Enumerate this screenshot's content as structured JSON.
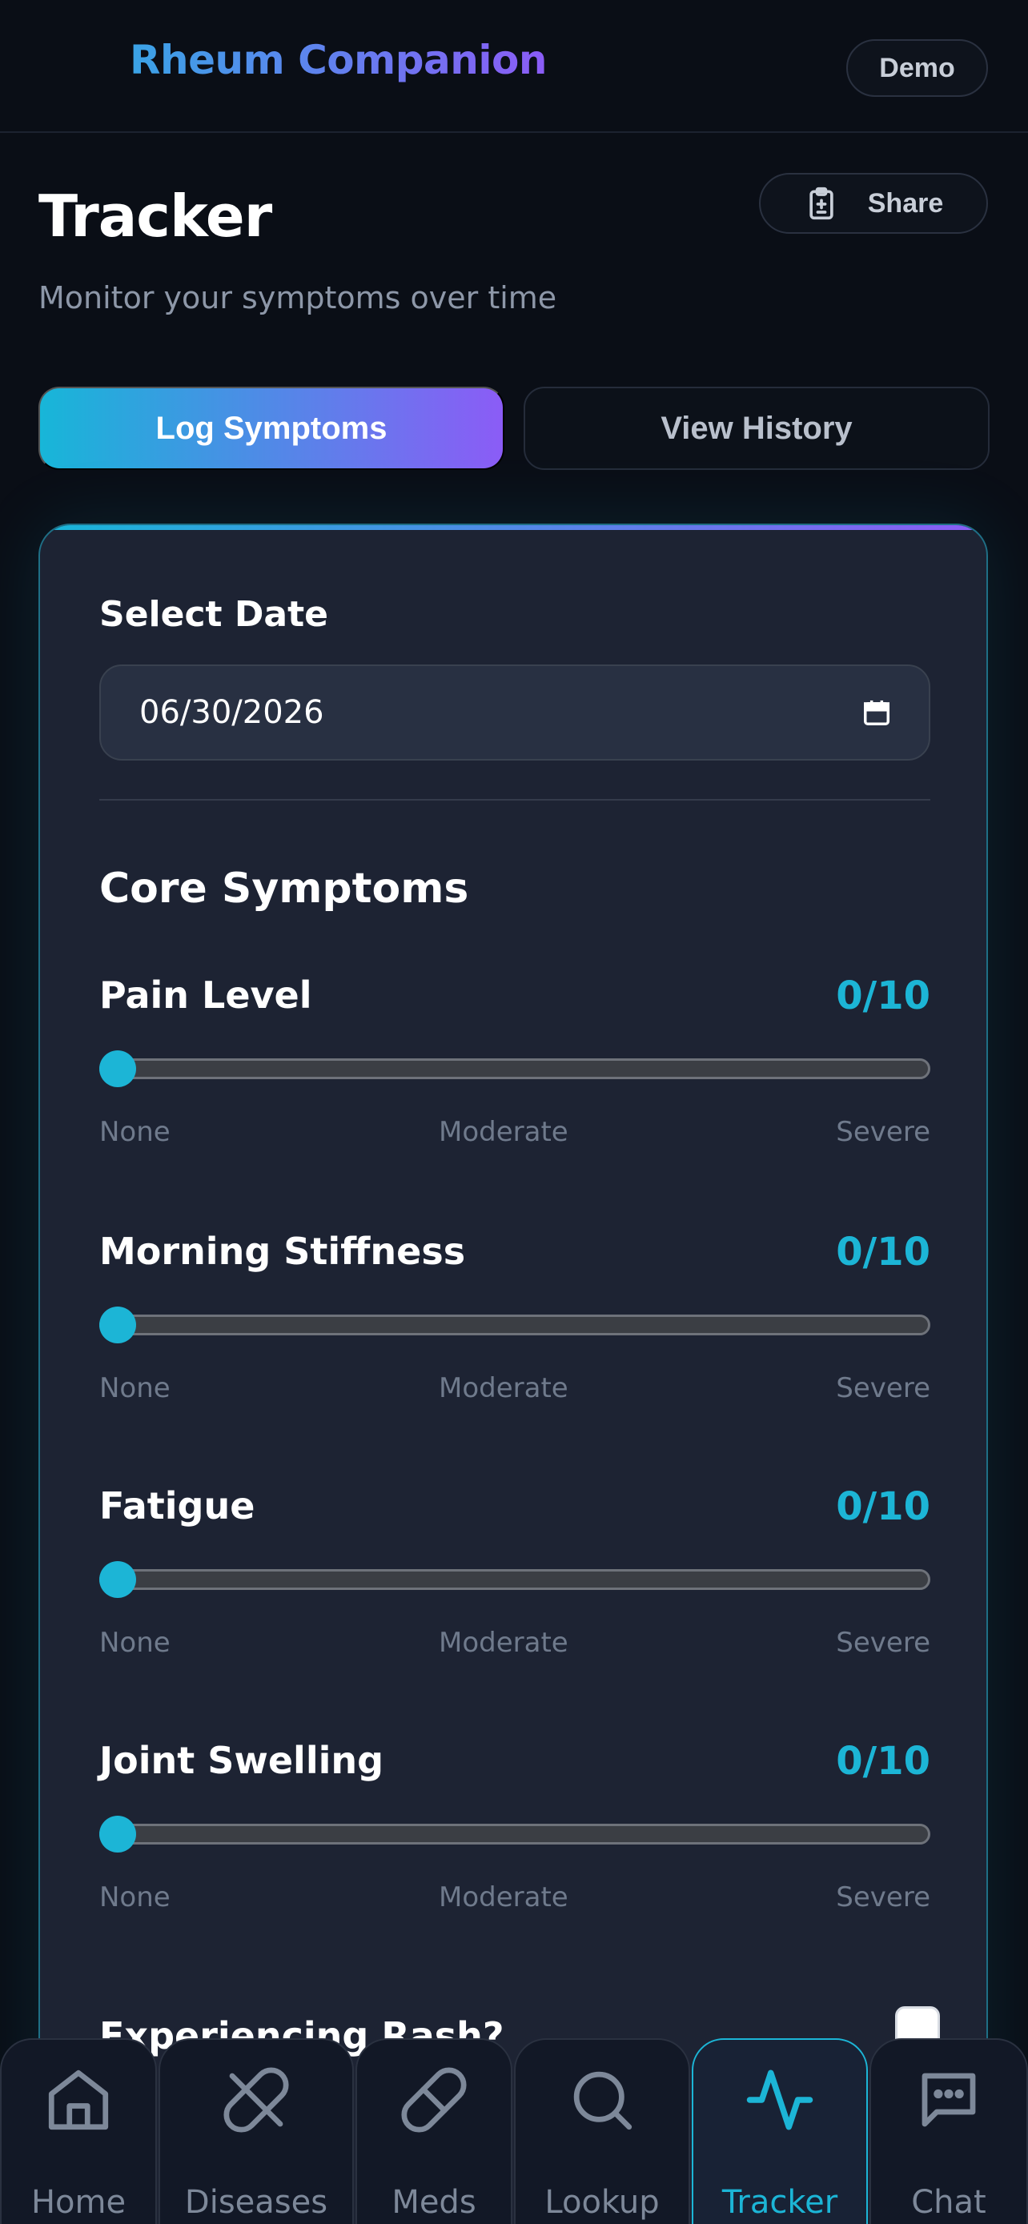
{
  "header": {
    "brand": "Rheum Companion",
    "demo_label": "Demo"
  },
  "page": {
    "title": "Tracker",
    "subtitle": "Monitor your symptoms over time",
    "share_label": "Share",
    "share_icon": "clipboard-icon"
  },
  "tabs": [
    {
      "label": "Log Symptoms",
      "active": true
    },
    {
      "label": "View History",
      "active": false
    }
  ],
  "date_section": {
    "label": "Select Date",
    "value": "06/30/2026",
    "icon": "calendar-icon"
  },
  "core_symptoms": {
    "title": "Core Symptoms",
    "scale": {
      "low": "None",
      "mid": "Moderate",
      "high": "Severe"
    },
    "items": [
      {
        "name": "Pain Level",
        "value_text": "0/10",
        "value": 0
      },
      {
        "name": "Morning Stiffness",
        "value_text": "0/10",
        "value": 0
      },
      {
        "name": "Fatigue",
        "value_text": "0/10",
        "value": 0
      },
      {
        "name": "Joint Swelling",
        "value_text": "0/10",
        "value": 0
      }
    ]
  },
  "rash": {
    "label": "Experiencing Rash?",
    "checked": false
  },
  "nav": [
    {
      "label": "Home",
      "icon": "home-icon",
      "active": false
    },
    {
      "label": "Diseases",
      "icon": "pill-slash-icon",
      "active": false
    },
    {
      "label": "Meds",
      "icon": "capsule-icon",
      "active": false
    },
    {
      "label": "Lookup",
      "icon": "search-icon",
      "active": false
    },
    {
      "label": "Tracker",
      "icon": "activity-icon",
      "active": true
    },
    {
      "label": "Chat",
      "icon": "chat-icon",
      "active": false
    }
  ],
  "colors": {
    "accent": "#1cb5d6",
    "accent_purple": "#8b5cf6",
    "background": "#0a0e16",
    "card": "#1d2333"
  }
}
